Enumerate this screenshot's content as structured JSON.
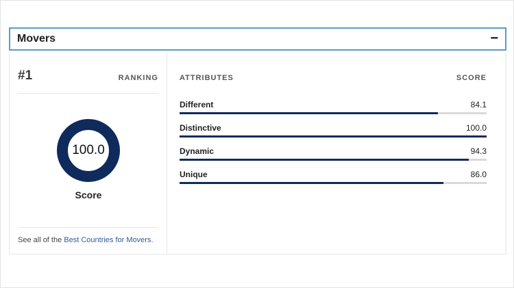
{
  "section": {
    "title": "Movers",
    "toggle_symbol": "−"
  },
  "ranking": {
    "rank": "#1",
    "label": "RANKING"
  },
  "score": {
    "value": "100.0",
    "fraction": 1.0,
    "label": "Score",
    "ring_color": "#0f2b5c"
  },
  "see_all": {
    "prefix": "See all of the ",
    "link": "Best Countries for Movers",
    "suffix": "."
  },
  "attributes": {
    "header_left": "ATTRIBUTES",
    "header_right": "SCORE",
    "bar_color": "#0f2b5c",
    "items": [
      {
        "name": "Different",
        "score": "84.1",
        "fraction": 0.841
      },
      {
        "name": "Distinctive",
        "score": "100.0",
        "fraction": 1.0
      },
      {
        "name": "Dynamic",
        "score": "94.3",
        "fraction": 0.943
      },
      {
        "name": "Unique",
        "score": "86.0",
        "fraction": 0.86
      }
    ]
  }
}
